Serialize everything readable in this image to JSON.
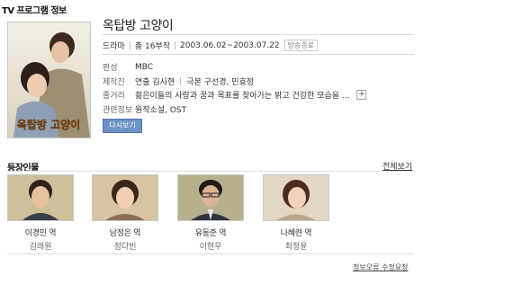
{
  "section": {
    "title": "TV 프로그램 정보"
  },
  "poster": {
    "alt_title_art": "옥탑방 고양이"
  },
  "program": {
    "title": "옥탑방 고양이",
    "genre": "드라마",
    "episodes": "총 16부작",
    "period": "2003.06.02~2003.07.22",
    "status_badge": "방송종료"
  },
  "info": {
    "broadcaster": {
      "label": "편성",
      "value": "MBC"
    },
    "crew": {
      "label": "제작진",
      "director": "연출 김사현",
      "writer": "극본 구선경, 민효정"
    },
    "plot": {
      "label": "줄거리",
      "value": "젊은이들의 사랑과 꿈과 목표를 찾아가는 밝고 건강한 모습을 ..."
    },
    "related": {
      "label": "관련정보",
      "value": "원작소설, OST"
    }
  },
  "buttons": {
    "replay": "다시보기",
    "expand": "+"
  },
  "cast_section": {
    "title": "등장인물",
    "more": "전체보기",
    "members": [
      {
        "role": "이경민 역",
        "actor": "김래원"
      },
      {
        "role": "남정은 역",
        "actor": "정다빈"
      },
      {
        "role": "유동준 역",
        "actor": "이현우"
      },
      {
        "role": "나혜련 역",
        "actor": "최정윤"
      }
    ]
  },
  "footer": {
    "report_link": "정보오류 수정요청"
  },
  "colors": {
    "button_blue": "#6d93c6",
    "border": "#c9c9c9"
  }
}
